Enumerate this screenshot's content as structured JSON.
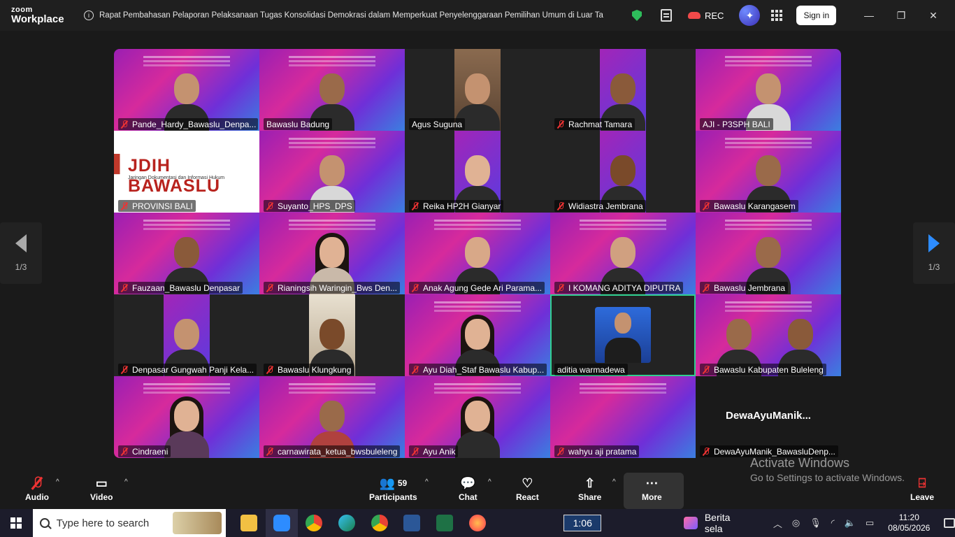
{
  "app": {
    "brand_top": "zoom",
    "brand_bottom": "Workplace"
  },
  "meeting": {
    "title": "Rapat Pembahasan Pelaporan Pelaksanaan Tugas Konsolidasi Demokrasi dalam Memperkuat Penyelenggaraan Pemilihan Umum di Luar Ta",
    "rec_label": "REC",
    "sign_in": "Sign in"
  },
  "participants": [
    {
      "name": "Pande_Hardy_Bawaslu_Denpa...",
      "muted": true
    },
    {
      "name": "Bawaslu Badung",
      "muted": false
    },
    {
      "name": "Agus Suguna",
      "muted": false
    },
    {
      "name": "Rachmat Tamara",
      "muted": true
    },
    {
      "name": "AJI - P3SPH BALI",
      "muted": false
    },
    {
      "name": "PROVINSI BALI",
      "muted": true
    },
    {
      "name": "Suyanto_HPS_DPS",
      "muted": true
    },
    {
      "name": "Reika  HP2H Gianyar",
      "muted": true
    },
    {
      "name": "Widiastra Jembrana",
      "muted": true
    },
    {
      "name": "Bawaslu Karangasem",
      "muted": true
    },
    {
      "name": "Fauzaan_Bawaslu Denpasar",
      "muted": true
    },
    {
      "name": "Rianingsih Waringin_Bws Den...",
      "muted": true
    },
    {
      "name": "Anak Agung Gede Ari Parama...",
      "muted": true
    },
    {
      "name": "I KOMANG ADITYA DIPUTRA",
      "muted": true
    },
    {
      "name": "Bawaslu Jembrana",
      "muted": true
    },
    {
      "name": "Denpasar Gungwah Panji Kela...",
      "muted": true
    },
    {
      "name": "Bawaslu Klungkung",
      "muted": true
    },
    {
      "name": "Ayu Diah_Staf Bawaslu Kabup...",
      "muted": true
    },
    {
      "name": "aditia warmadewa",
      "muted": false
    },
    {
      "name": "Bawaslu Kabupaten Buleleng",
      "muted": true
    },
    {
      "name": "Cindraeni",
      "muted": true
    },
    {
      "name": "carnawirata_ketua_bwsbuleleng",
      "muted": true
    },
    {
      "name": "Ayu Anik",
      "muted": true
    },
    {
      "name": "wahyu aji pratama",
      "muted": true
    },
    {
      "name": "DewaAyuManik_BawasluDenp...",
      "muted": true,
      "display_name": "DewaAyuManik..."
    }
  ],
  "jdih": {
    "logo_text": "JDIH BAWASLU",
    "sub_text": "Jaringan Dokumentasi dan Informasi Hukum"
  },
  "pagination": {
    "left": "1/3",
    "right": "1/3"
  },
  "toolbar": {
    "audio": "Audio",
    "video": "Video",
    "participants": "Participants",
    "participants_count": "59",
    "chat": "Chat",
    "react": "React",
    "share": "Share",
    "more": "More",
    "leave": "Leave"
  },
  "watermark": {
    "line1": "Activate Windows",
    "line2": "Go to Settings to activate Windows."
  },
  "taskbar": {
    "search_placeholder": "Type here to search",
    "timer": "1:06",
    "news": "Berita sela",
    "time": "11:20",
    "date": "08/05/2026"
  }
}
